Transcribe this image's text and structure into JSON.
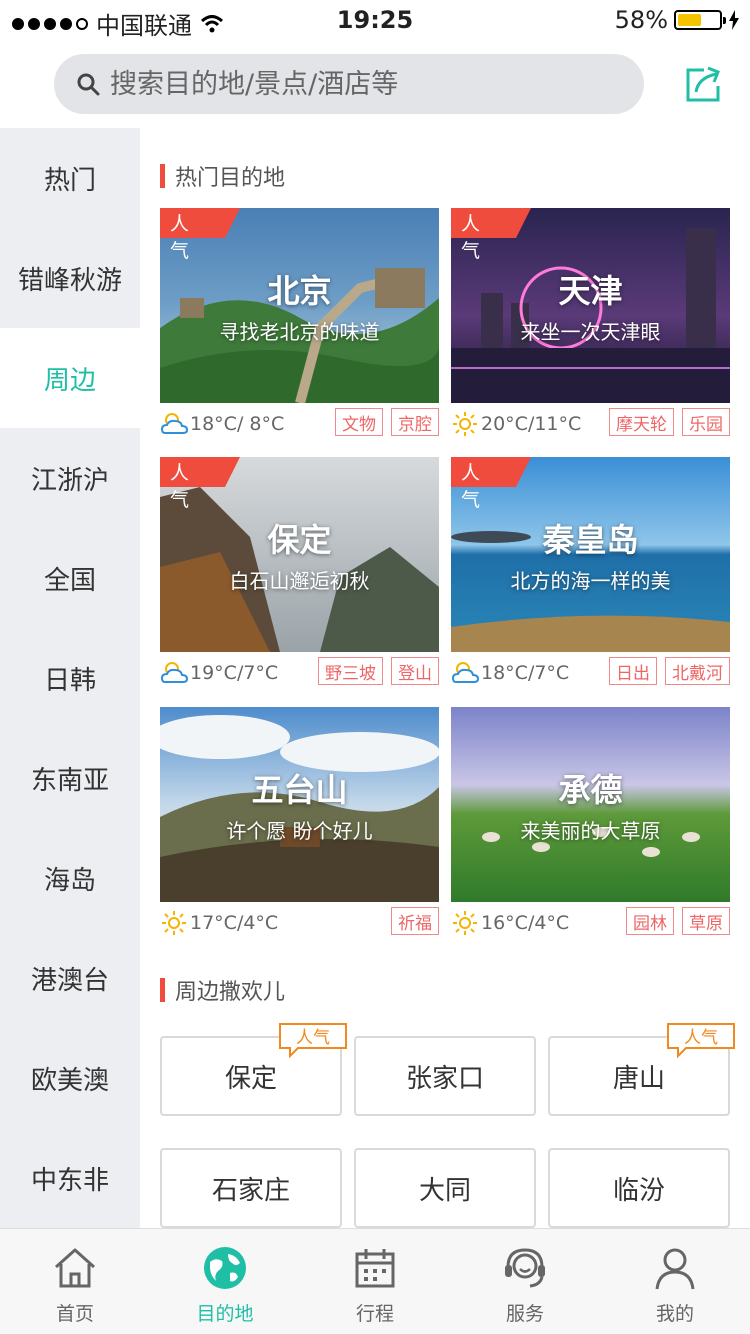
{
  "status_bar": {
    "carrier": "中国联通",
    "time": "19:25",
    "battery": "58%",
    "battery_level": 0.58
  },
  "search": {
    "placeholder": "搜索目的地/景点/酒店等"
  },
  "sidebar": {
    "items": [
      {
        "label": "热门"
      },
      {
        "label": "错峰秋游"
      },
      {
        "label": "周边"
      },
      {
        "label": "江浙沪"
      },
      {
        "label": "全国"
      },
      {
        "label": "日韩"
      },
      {
        "label": "东南亚"
      },
      {
        "label": "海岛"
      },
      {
        "label": "港澳台"
      },
      {
        "label": "欧美澳"
      },
      {
        "label": "中东非"
      }
    ],
    "active": "周边"
  },
  "hot_section": {
    "title": "热门目的地"
  },
  "destinations": [
    {
      "badge": "人气",
      "name": "北京",
      "subtitle": "寻找老北京的味道",
      "weather": "partly-cloudy-icon",
      "temp": "18°C/ 8°C",
      "tags": [
        "文物",
        "京腔"
      ]
    },
    {
      "badge": "人气",
      "name": "天津",
      "subtitle": "来坐一次天津眼",
      "weather": "sunny-icon",
      "temp": "20°C/11°C",
      "tags": [
        "摩天轮",
        "乐园"
      ]
    },
    {
      "badge": "人气",
      "name": "保定",
      "subtitle": "白石山邂逅初秋",
      "weather": "partly-cloudy-icon",
      "temp": "19°C/7°C",
      "tags": [
        "野三坡",
        "登山"
      ]
    },
    {
      "badge": "人气",
      "name": "秦皇岛",
      "subtitle": "北方的海一样的美",
      "weather": "partly-cloudy-icon",
      "temp": "18°C/7°C",
      "tags": [
        "日出",
        "北戴河"
      ]
    },
    {
      "badge": "",
      "name": "五台山",
      "subtitle": "许个愿 盼个好儿",
      "weather": "sunny-icon",
      "temp": "17°C/4°C",
      "tags": [
        "祈福"
      ]
    },
    {
      "badge": "",
      "name": "承德",
      "subtitle": "来美丽的大草原",
      "weather": "sunny-icon",
      "temp": "16°C/4°C",
      "tags": [
        "园林",
        "草原"
      ]
    }
  ],
  "nearby_section": {
    "title": "周边撒欢儿"
  },
  "nearby": [
    {
      "label": "保定",
      "badge": "人气"
    },
    {
      "label": "张家口",
      "badge": ""
    },
    {
      "label": "唐山",
      "badge": "人气"
    },
    {
      "label": "石家庄",
      "badge": ""
    },
    {
      "label": "大同",
      "badge": ""
    },
    {
      "label": "临汾",
      "badge": ""
    }
  ],
  "tabbar": {
    "items": [
      {
        "label": "首页",
        "icon": "home-icon"
      },
      {
        "label": "目的地",
        "icon": "globe-icon"
      },
      {
        "label": "行程",
        "icon": "calendar-icon"
      },
      {
        "label": "服务",
        "icon": "headset-icon"
      },
      {
        "label": "我的",
        "icon": "user-icon"
      }
    ],
    "active": "目的地"
  },
  "colors": {
    "accent": "#1fbfa6",
    "tag_red": "#f04c3e",
    "hot_orange": "#f08a1e",
    "sidebar_bg": "#eceef2"
  }
}
